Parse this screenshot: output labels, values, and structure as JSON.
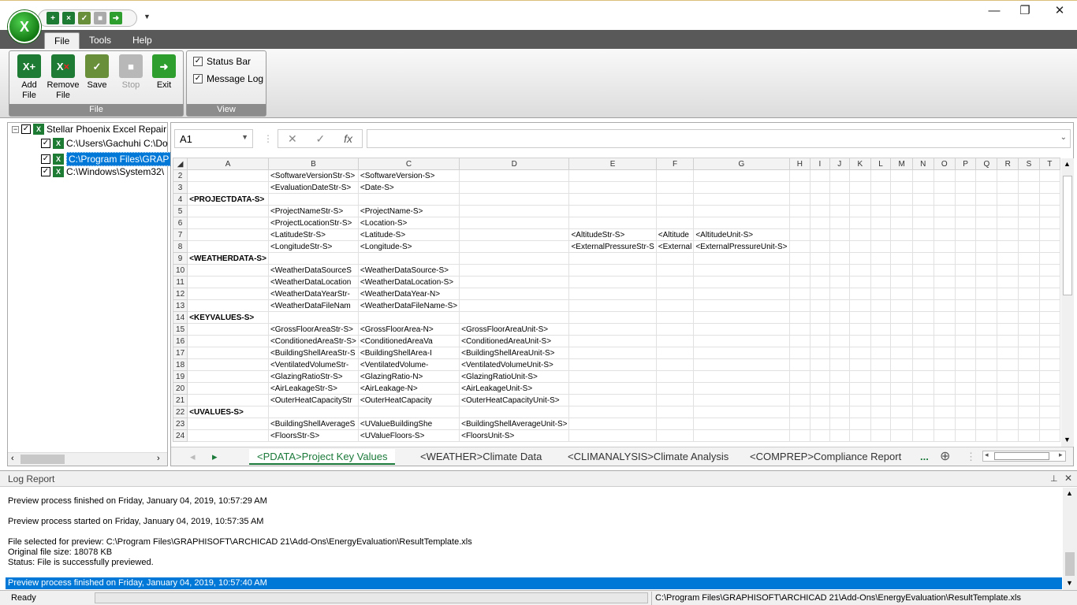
{
  "quick_access": {
    "icons": [
      "add-file-icon",
      "remove-file-icon",
      "save-icon",
      "stop-icon",
      "exit-icon"
    ]
  },
  "window": {
    "minimize": "—",
    "maximize": "❐",
    "close": "✕"
  },
  "menu": {
    "tabs": [
      {
        "label": "File"
      },
      {
        "label": "Tools"
      },
      {
        "label": "Help"
      }
    ]
  },
  "ribbon": {
    "file_group": {
      "label": "File",
      "buttons": [
        {
          "label": "Add\nFile",
          "l1": "Add",
          "l2": "File"
        },
        {
          "label": "Remove File",
          "l1": "Remove",
          "l2": "File"
        },
        {
          "label": "Save",
          "l1": "Save",
          "l2": ""
        },
        {
          "label": "Stop",
          "l1": "Stop",
          "l2": ""
        },
        {
          "label": "Exit",
          "l1": "Exit",
          "l2": ""
        }
      ]
    },
    "view_group": {
      "label": "View",
      "status_bar": "Status Bar",
      "message_log": "Message Log"
    }
  },
  "tree": {
    "root": "Stellar Phoenix Excel Repair",
    "items": [
      "C:\\Users\\Gachuhi C:\\Do",
      "C:\\Program Files\\GRAP",
      "C:\\Windows\\System32\\"
    ],
    "selected_index": 1
  },
  "formula": {
    "namebox": "A1",
    "cancel": "✕",
    "enter": "✓",
    "fx": "fx"
  },
  "grid": {
    "columns": [
      "A",
      "B",
      "C",
      "D",
      "E",
      "F",
      "G",
      "H",
      "I",
      "J",
      "K",
      "L",
      "M",
      "N",
      "O",
      "P",
      "Q",
      "R",
      "S",
      "T"
    ],
    "rows": [
      {
        "n": "2",
        "cells": [
          "",
          "<SoftwareVersionStr-S>",
          "<SoftwareVersion-S>",
          "",
          "",
          "",
          "",
          "",
          "",
          "",
          "",
          "",
          "",
          "",
          "",
          "",
          "",
          "",
          "",
          ""
        ]
      },
      {
        "n": "3",
        "cells": [
          "",
          "<EvaluationDateStr-S>",
          "<Date-S>",
          "",
          "",
          "",
          "",
          "",
          "",
          "",
          "",
          "",
          "",
          "",
          "",
          "",
          "",
          "",
          "",
          ""
        ]
      },
      {
        "n": "4",
        "bold": true,
        "cells": [
          "<PROJECTDATA-S>",
          "",
          "",
          "",
          "",
          "",
          "",
          "",
          "",
          "",
          "",
          "",
          "",
          "",
          "",
          "",
          "",
          "",
          "",
          ""
        ]
      },
      {
        "n": "5",
        "cells": [
          "",
          "<ProjectNameStr-S>",
          "<ProjectName-S>",
          "",
          "",
          "",
          "",
          "",
          "",
          "",
          "",
          "",
          "",
          "",
          "",
          "",
          "",
          "",
          "",
          ""
        ]
      },
      {
        "n": "6",
        "cells": [
          "",
          "<ProjectLocationStr-S>",
          "<Location-S>",
          "",
          "",
          "",
          "",
          "",
          "",
          "",
          "",
          "",
          "",
          "",
          "",
          "",
          "",
          "",
          "",
          ""
        ]
      },
      {
        "n": "7",
        "cells": [
          "",
          "<LatitudeStr-S>",
          "<Latitude-S>",
          "",
          "<AltitudeStr-S>",
          "<Altitude",
          "<AltitudeUnit-S>",
          "",
          "",
          "",
          "",
          "",
          "",
          "",
          "",
          "",
          "",
          "",
          "",
          ""
        ]
      },
      {
        "n": "8",
        "cells": [
          "",
          "<LongitudeStr-S>",
          "<Longitude-S>",
          "",
          "<ExternalPressureStr-S",
          "<External",
          "<ExternalPressureUnit-S>",
          "",
          "",
          "",
          "",
          "",
          "",
          "",
          "",
          "",
          "",
          "",
          "",
          ""
        ]
      },
      {
        "n": "9",
        "bold": true,
        "cells": [
          "<WEATHERDATA-S>",
          "",
          "",
          "",
          "",
          "",
          "",
          "",
          "",
          "",
          "",
          "",
          "",
          "",
          "",
          "",
          "",
          "",
          "",
          ""
        ]
      },
      {
        "n": "10",
        "cells": [
          "",
          "<WeatherDataSourceS",
          "<WeatherDataSource-S>",
          "",
          "",
          "",
          "",
          "",
          "",
          "",
          "",
          "",
          "",
          "",
          "",
          "",
          "",
          "",
          "",
          ""
        ]
      },
      {
        "n": "11",
        "cells": [
          "",
          "<WeatherDataLocation",
          "<WeatherDataLocation-S>",
          "",
          "",
          "",
          "",
          "",
          "",
          "",
          "",
          "",
          "",
          "",
          "",
          "",
          "",
          "",
          "",
          ""
        ]
      },
      {
        "n": "12",
        "cells": [
          "",
          "<WeatherDataYearStr-",
          "<WeatherDataYear-N>",
          "",
          "",
          "",
          "",
          "",
          "",
          "",
          "",
          "",
          "",
          "",
          "",
          "",
          "",
          "",
          "",
          ""
        ]
      },
      {
        "n": "13",
        "cells": [
          "",
          "<WeatherDataFileNam",
          "<WeatherDataFileName-S>",
          "",
          "",
          "",
          "",
          "",
          "",
          "",
          "",
          "",
          "",
          "",
          "",
          "",
          "",
          "",
          "",
          ""
        ]
      },
      {
        "n": "14",
        "bold": true,
        "cells": [
          "<KEYVALUES-S>",
          "",
          "",
          "",
          "",
          "",
          "",
          "",
          "",
          "",
          "",
          "",
          "",
          "",
          "",
          "",
          "",
          "",
          "",
          ""
        ]
      },
      {
        "n": "15",
        "cells": [
          "",
          "<GrossFloorAreaStr-S>",
          "<GrossFloorArea-N>",
          "<GrossFloorAreaUnit-S>",
          "",
          "",
          "",
          "",
          "",
          "",
          "",
          "",
          "",
          "",
          "",
          "",
          "",
          "",
          "",
          ""
        ]
      },
      {
        "n": "16",
        "cells": [
          "",
          "<ConditionedAreaStr-S>",
          "<ConditionedAreaVa",
          "<ConditionedAreaUnit-S>",
          "",
          "",
          "",
          "",
          "",
          "",
          "",
          "",
          "",
          "",
          "",
          "",
          "",
          "",
          "",
          ""
        ]
      },
      {
        "n": "17",
        "cells": [
          "",
          "<BuildingShellAreaStr-S",
          "<BuildingShellArea-I",
          "<BuildingShellAreaUnit-S>",
          "",
          "",
          "",
          "",
          "",
          "",
          "",
          "",
          "",
          "",
          "",
          "",
          "",
          "",
          "",
          ""
        ]
      },
      {
        "n": "18",
        "cells": [
          "",
          "<VentilatedVolumeStr-",
          "<VentilatedVolume-",
          "<VentilatedVolumeUnit-S>",
          "",
          "",
          "",
          "",
          "",
          "",
          "",
          "",
          "",
          "",
          "",
          "",
          "",
          "",
          "",
          ""
        ]
      },
      {
        "n": "19",
        "cells": [
          "",
          "<GlazingRatioStr-S>",
          "<GlazingRatio-N>",
          "<GlazingRatioUnit-S>",
          "",
          "",
          "",
          "",
          "",
          "",
          "",
          "",
          "",
          "",
          "",
          "",
          "",
          "",
          "",
          ""
        ]
      },
      {
        "n": "20",
        "cells": [
          "",
          "<AirLeakageStr-S>",
          "<AirLeakage-N>",
          "<AirLeakageUnit-S>",
          "",
          "",
          "",
          "",
          "",
          "",
          "",
          "",
          "",
          "",
          "",
          "",
          "",
          "",
          "",
          ""
        ]
      },
      {
        "n": "21",
        "cells": [
          "",
          "<OuterHeatCapacityStr",
          "<OuterHeatCapacity",
          "<OuterHeatCapacityUnit-S>",
          "",
          "",
          "",
          "",
          "",
          "",
          "",
          "",
          "",
          "",
          "",
          "",
          "",
          "",
          "",
          ""
        ]
      },
      {
        "n": "22",
        "bold": true,
        "cells": [
          "<UVALUES-S>",
          "",
          "",
          "",
          "",
          "",
          "",
          "",
          "",
          "",
          "",
          "",
          "",
          "",
          "",
          "",
          "",
          "",
          "",
          ""
        ]
      },
      {
        "n": "23",
        "cells": [
          "",
          "<BuildingShellAverageS",
          "<UValueBuildingShe",
          "<BuildingShellAverageUnit-S>",
          "",
          "",
          "",
          "",
          "",
          "",
          "",
          "",
          "",
          "",
          "",
          "",
          "",
          "",
          "",
          ""
        ]
      },
      {
        "n": "24",
        "cells": [
          "",
          "<FloorsStr-S>",
          "<UValueFloors-S>",
          "<FloorsUnit-S>",
          "",
          "",
          "",
          "",
          "",
          "",
          "",
          "",
          "",
          "",
          "",
          "",
          "",
          "",
          "",
          ""
        ]
      }
    ]
  },
  "sheet_tabs": {
    "tabs": [
      "<PDATA>Project Key Values",
      "<WEATHER>Climate Data",
      "<CLIMANALYSIS>Climate Analysis",
      "<COMPREP>Compliance Report"
    ],
    "more": "...",
    "add": "⊕"
  },
  "log": {
    "title": "Log Report",
    "lines": [
      "Preview process finished on Friday, January 04, 2019, 10:57:29 AM",
      "Preview process started on Friday, January 04, 2019, 10:57:35 AM",
      "File selected for preview: C:\\Program Files\\GRAPHISOFT\\ARCHICAD 21\\Add-Ons\\EnergyEvaluation\\ResultTemplate.xls",
      "Original file size: 18078 KB",
      "Status: File is successfully previewed."
    ],
    "highlighted": "Preview process finished on Friday, January 04, 2019, 10:57:40 AM"
  },
  "status": {
    "ready": "Ready",
    "path": "C:\\Program Files\\GRAPHISOFT\\ARCHICAD 21\\Add-Ons\\EnergyEvaluation\\ResultTemplate.xls"
  }
}
